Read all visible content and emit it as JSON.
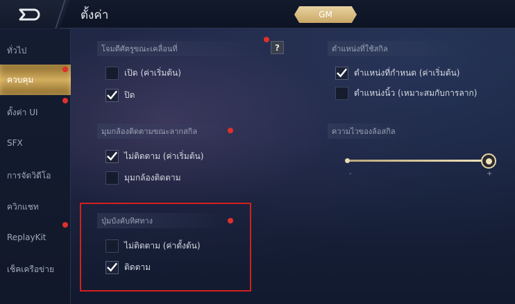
{
  "header": {
    "title": "ตั้งค่า",
    "gm_label": "GM"
  },
  "sidebar": {
    "items": [
      {
        "label": "ทั่วไป"
      },
      {
        "label": "ควบคุม"
      },
      {
        "label": "ตั้งค่า UI"
      },
      {
        "label": "SFX"
      },
      {
        "label": "การจัดวิดีโอ"
      },
      {
        "label": "ควิกแชท"
      },
      {
        "label": "ReplayKit"
      },
      {
        "label": "เช็คเครือข่าย"
      }
    ],
    "active_index": 1
  },
  "sections": {
    "enemy_lock": {
      "title": "โจมตีศัตรูขณะเคลื่อนที่",
      "help": "?",
      "options": [
        {
          "label": "เปิด (ค่าเริ่มต้น)",
          "checked": false
        },
        {
          "label": "ปิด",
          "checked": true
        }
      ]
    },
    "camera_follow": {
      "title": "มุมกล้องติดตามขณะลากสกิล",
      "options": [
        {
          "label": "ไม่ติดตาม (ค่าเริ่มต้น)",
          "checked": true
        },
        {
          "label": "มุมกล้องติดตาม",
          "checked": false
        }
      ]
    },
    "direction_button": {
      "title": "ปุ่มบังคับทิศทาง",
      "options": [
        {
          "label": "ไม่ติดตาม (ค่าตั้งต้น)",
          "checked": false
        },
        {
          "label": "ติดตาม",
          "checked": true
        }
      ]
    },
    "skill_position": {
      "title": "ตำแหน่งที่ใช้สกิล",
      "options": [
        {
          "label": "ตำแหน่งที่กำหนด (ค่าเริ่มต้น)",
          "checked": true
        },
        {
          "label": "ตำแหน่งนิ้ว (เหมาะสมกับการลาก)",
          "checked": false
        }
      ]
    },
    "wheel_sensitivity": {
      "title": "ความไวของล้อสกิล",
      "minus": "-",
      "plus": "+",
      "value_fraction": 1.0
    }
  },
  "colors": {
    "accent_gold": "#d3ae5f",
    "notify_red": "#e0302c",
    "highlight_red": "#d41f1f"
  }
}
